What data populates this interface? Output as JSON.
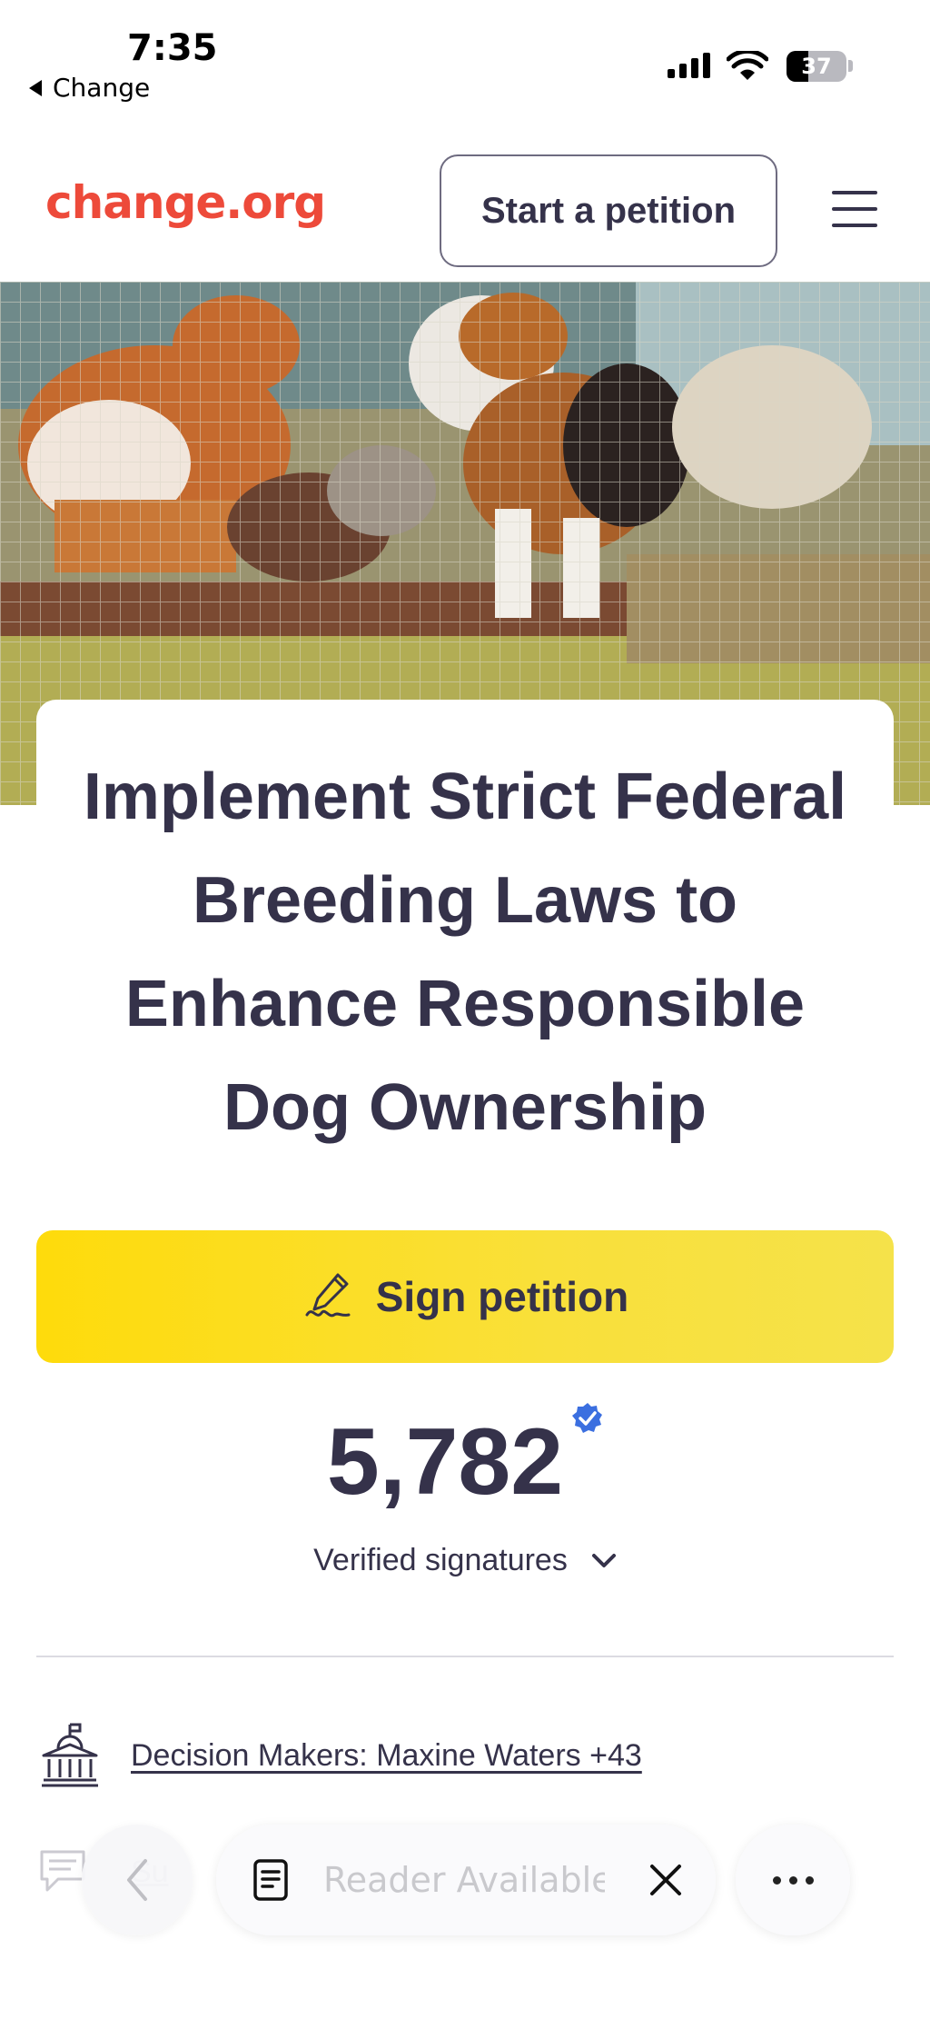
{
  "status_bar": {
    "time": "7:35",
    "back_app": "Change",
    "battery": "37",
    "battery_level": 0.37
  },
  "header": {
    "logo": "change.org",
    "start_petition_label": "Start a petition",
    "brand_color": "#ed4a3a"
  },
  "petition": {
    "title": "Implement Strict Federal Breeding Laws to Enhance Responsible Dog Ownership",
    "sign_label": "Sign petition",
    "signature_count": "5,782",
    "verified_label": "Verified signatures",
    "decision_makers_link": "Decision Makers: Maxine Waters +43",
    "partial_row_text": "Su"
  },
  "browser_bar": {
    "reader_placeholder": "Reader Available"
  },
  "colors": {
    "button_yellow": "#fedb0b",
    "text_dark": "#35324a",
    "verified_blue": "#3b6fe0"
  }
}
